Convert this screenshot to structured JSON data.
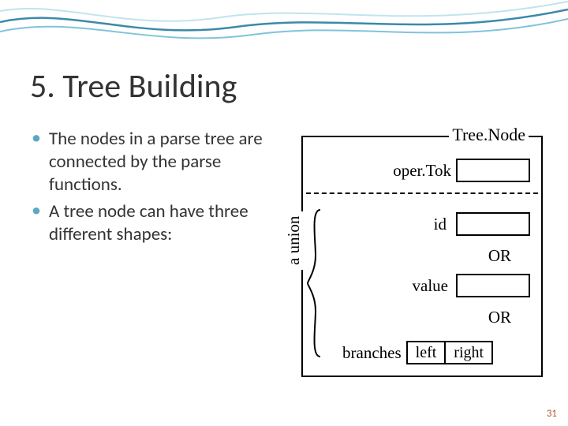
{
  "title": "5. Tree Building",
  "bullets": [
    "The nodes in a parse tree are connected by the parse functions.",
    "A tree node can have three different shapes:"
  ],
  "diagram": {
    "title": "Tree.Node",
    "operTok": "oper.Tok",
    "id": "id",
    "value": "value",
    "or": "OR",
    "unionLabel": "a union",
    "branches": "branches",
    "left": "left",
    "right": "right"
  },
  "page": "31"
}
